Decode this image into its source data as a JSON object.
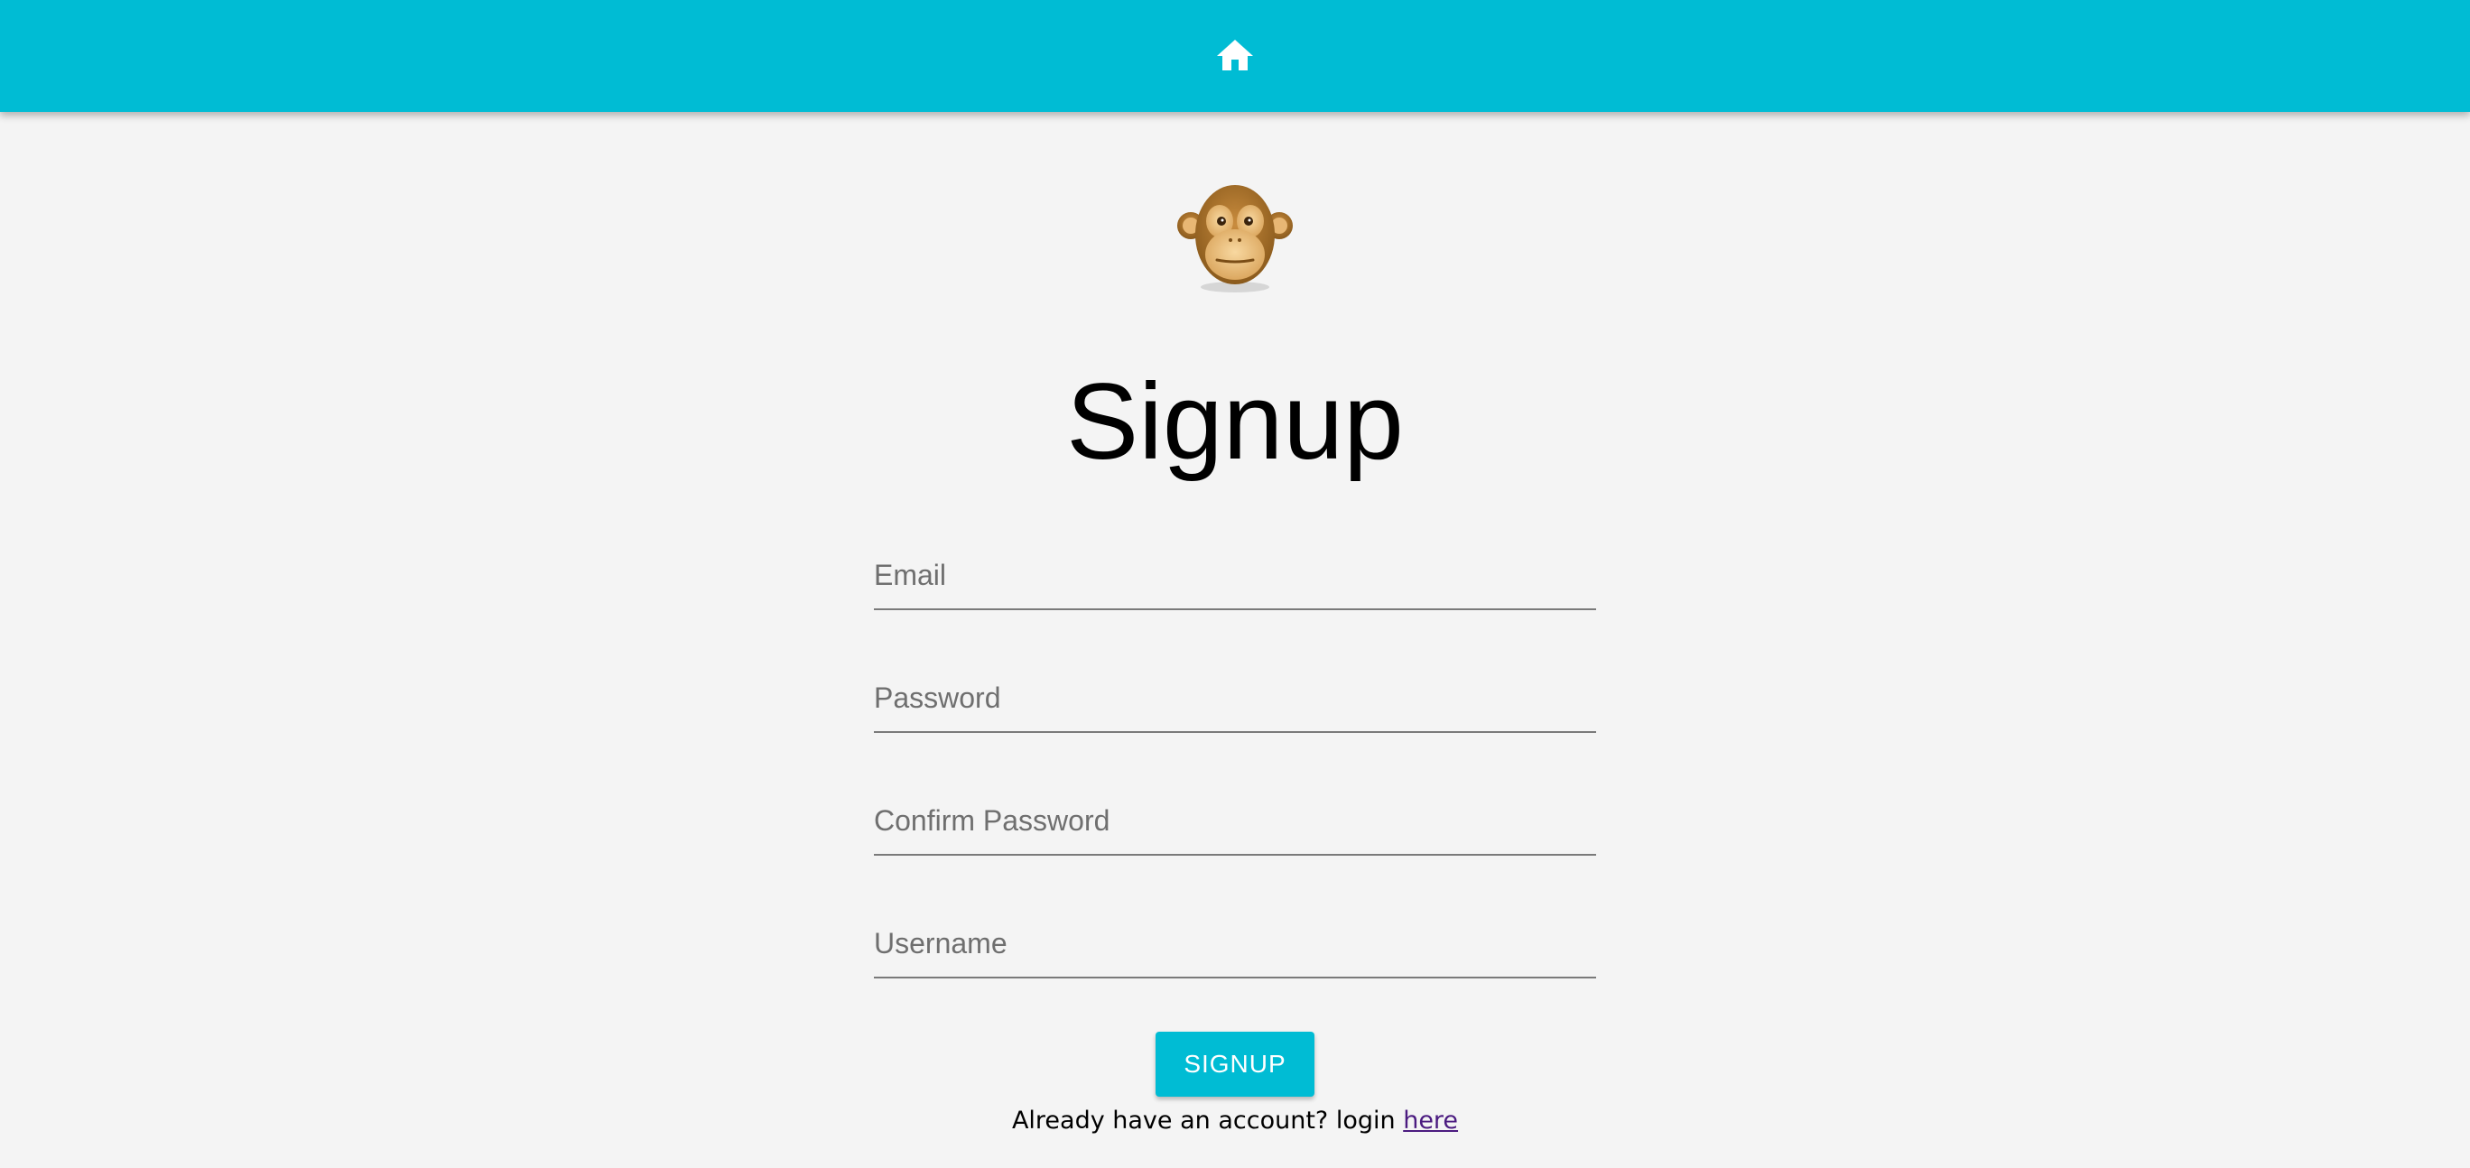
{
  "header": {
    "home_icon": "home-icon",
    "color": "#00bcd4"
  },
  "logo": {
    "icon": "monkey-face-icon"
  },
  "page": {
    "title": "Signup"
  },
  "form": {
    "email": {
      "placeholder": "Email",
      "value": ""
    },
    "password": {
      "placeholder": "Password",
      "value": ""
    },
    "confirm_password": {
      "placeholder": "Confirm Password",
      "value": ""
    },
    "username": {
      "placeholder": "Username",
      "value": ""
    },
    "submit_label": "SIGNUP"
  },
  "footer": {
    "prompt": "Already have an account? login",
    "link_label": "here"
  }
}
